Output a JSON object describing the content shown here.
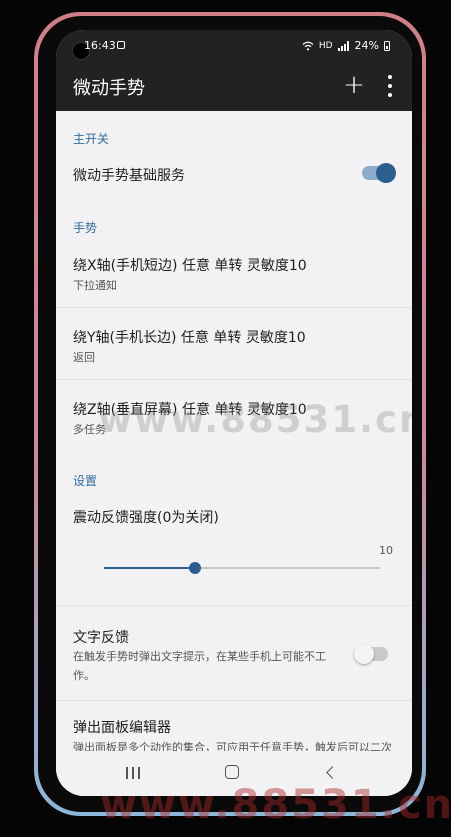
{
  "status_bar": {
    "time": "16:43",
    "battery": "24%",
    "icons": [
      "wifi-icon",
      "hd-icon",
      "signal-icon",
      "battery-icon"
    ],
    "hd_label": "HD"
  },
  "app_bar": {
    "title": "微动手势",
    "add_label": "+"
  },
  "sections": {
    "main_switch": {
      "header": "主开关",
      "service_title": "微动手势基础服务",
      "service_enabled": true
    },
    "gestures": {
      "header": "手势",
      "items": [
        {
          "title": "绕X轴(手机短边) 任意 单转 灵敏度10",
          "summary": "下拉通知"
        },
        {
          "title": "绕Y轴(手机长边) 任意 单转 灵敏度10",
          "summary": "返回"
        },
        {
          "title": "绕Z轴(垂直屏幕) 任意 单转 灵敏度10",
          "summary": "多任务"
        }
      ]
    },
    "settings": {
      "header": "设置",
      "vibration": {
        "title": "震动反馈强度(0为关闭)",
        "value": "10",
        "fraction": 0.33
      },
      "text_feedback": {
        "title": "文字反馈",
        "summary": "在触发手势时弹出文字提示，在某些手机上可能不工作。",
        "enabled": false
      },
      "panel_editor": {
        "title": "弹出面板编辑器",
        "summary": "弹出面板是多个动作的集合，可应用于任意手势，触发后可以二次选择。"
      }
    }
  },
  "watermark": "www.88531.cn",
  "colors": {
    "accent": "#2d5f8e",
    "section_header": "#336a9c",
    "app_bar": "#222224",
    "background": "#f2f2f5"
  }
}
